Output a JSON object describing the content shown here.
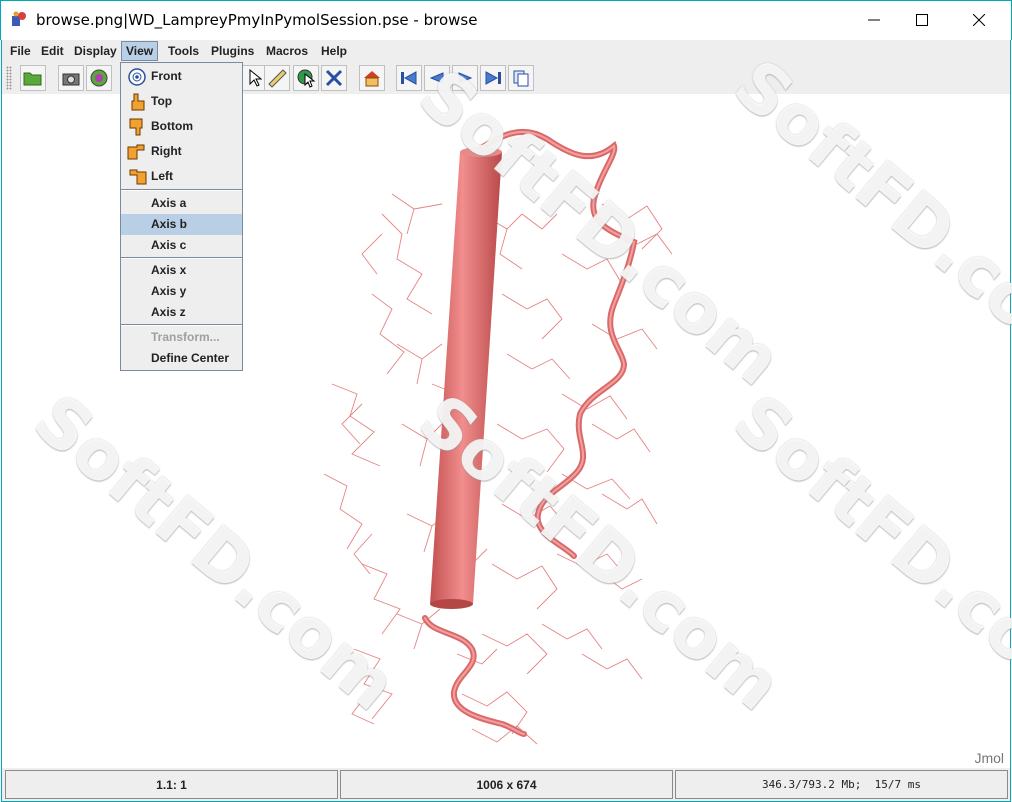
{
  "window": {
    "title": "browse.png|WD_LampreyPmyInPymolSession.pse - browse",
    "icon": "jmol-app-icon",
    "controls": [
      "minimize-icon",
      "maximize-icon",
      "close-icon"
    ]
  },
  "menubar": {
    "items": [
      {
        "label": "File"
      },
      {
        "label": "Edit"
      },
      {
        "label": "Display"
      },
      {
        "label": "View",
        "active": true
      },
      {
        "label": "Tools"
      },
      {
        "label": "Plugins"
      },
      {
        "label": "Macros"
      },
      {
        "label": "Help"
      }
    ]
  },
  "toolbar": {
    "buttons": [
      "open-folder-icon",
      "camera-icon",
      "web-export-icon",
      "select-cursor-icon",
      "ruler-icon",
      "pick-icon",
      "navigate-icon",
      "home-icon",
      "first-frame-icon",
      "previous-frame-icon",
      "next-frame-icon",
      "last-frame-icon",
      "copy-icon"
    ]
  },
  "view_menu": {
    "items": [
      {
        "label": "Front",
        "icon": "front-view-icon"
      },
      {
        "label": "Top",
        "icon": "hand-top-icon"
      },
      {
        "label": "Bottom",
        "icon": "hand-bottom-icon"
      },
      {
        "label": "Right",
        "icon": "hand-right-icon"
      },
      {
        "label": "Left",
        "icon": "hand-left-icon"
      },
      {
        "label": "Axis a"
      },
      {
        "label": "Axis b",
        "selected": true
      },
      {
        "label": "Axis c"
      },
      {
        "label": "Axis x"
      },
      {
        "label": "Axis y"
      },
      {
        "label": "Axis z"
      },
      {
        "label": "Transform...",
        "disabled": true
      },
      {
        "label": "Define Center"
      }
    ]
  },
  "viewer": {
    "brand": "Jmol",
    "helix_color": "#e07070",
    "sidechain_color": "#e88080"
  },
  "status": {
    "left": "1.1: 1",
    "center": "1006 x 674",
    "right": "346.3/793.2 Mb;  15/7 ms"
  },
  "watermark": "SoftFD.com",
  "colors": {
    "accent_border": "#00a9b8",
    "menu_highlight": "#b8cfe5",
    "panel_bg": "#eeeeee"
  }
}
